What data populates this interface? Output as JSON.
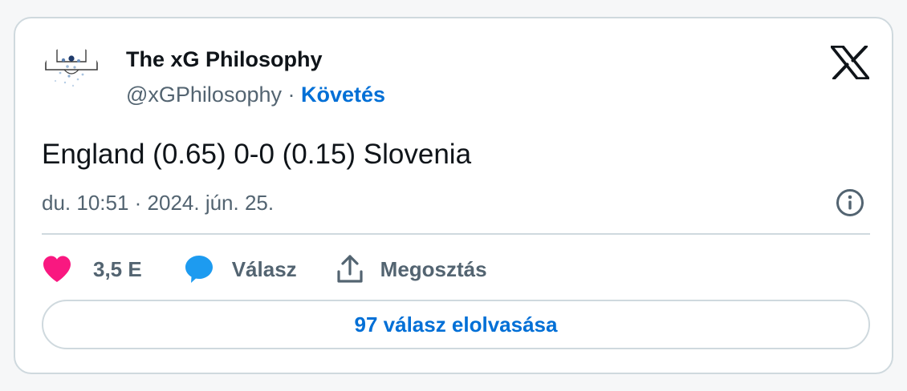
{
  "author": {
    "name": "The xG Philosophy",
    "handle": "@xGPhilosophy",
    "separator": "·",
    "follow_label": "Követés"
  },
  "tweet": {
    "text": "England (0.65) 0-0 (0.15) Slovenia",
    "timestamp": "du. 10:51 · 2024. jún. 25."
  },
  "actions": {
    "like_count": "3,5 E",
    "reply_label": "Válasz",
    "share_label": "Megosztás"
  },
  "replies_button_label": "97 válasz elolvasása",
  "icons": {
    "logo": "x-logo-icon",
    "info": "info-icon",
    "like": "heart-icon",
    "reply": "speech-bubble-icon",
    "share": "share-upload-icon",
    "avatar": "football-pitch-avatar"
  },
  "colors": {
    "link": "#006fd6",
    "heart": "#f91880",
    "reply_bubble": "#1d9bf0",
    "text_primary": "#0f1419",
    "text_secondary": "#536471",
    "border": "#cfd9de"
  }
}
